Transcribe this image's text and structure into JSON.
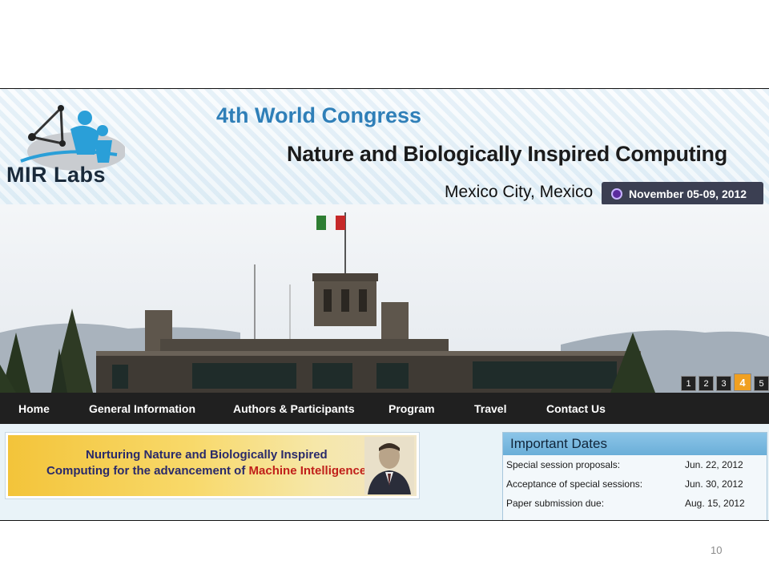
{
  "header": {
    "logo_text": "MIR Labs",
    "congress": "4th World Congress",
    "subtitle": "Nature and Biologically Inspired Computing",
    "location": "Mexico City, Mexico",
    "date": "November 05-09, 2012"
  },
  "slider": {
    "pages": [
      "1",
      "2",
      "3",
      "4",
      "5"
    ],
    "active": "4"
  },
  "nav": {
    "home": "Home",
    "general": "General Information",
    "authors": "Authors & Participants",
    "program": "Program",
    "travel": "Travel",
    "contact": "Contact Us"
  },
  "promo": {
    "line1": "Nurturing Nature and Biologically Inspired",
    "line2_prefix": "Computing for the advancement of ",
    "line2_highlight": "Machine Intelligence"
  },
  "important_dates": {
    "title": "Important Dates",
    "rows": [
      {
        "label": "Special session proposals:",
        "value": "Jun. 22, 2012"
      },
      {
        "label": "Acceptance of special sessions:",
        "value": "Jun. 30, 2012"
      },
      {
        "label": "Paper submission due:",
        "value": "Aug. 15, 2012"
      }
    ]
  },
  "slide_number": "10",
  "colors": {
    "nav_bg": "#202020",
    "congress_blue": "#2f7fb8",
    "badge_bg": "#3b3f52",
    "active_slide": "#f0a020"
  }
}
